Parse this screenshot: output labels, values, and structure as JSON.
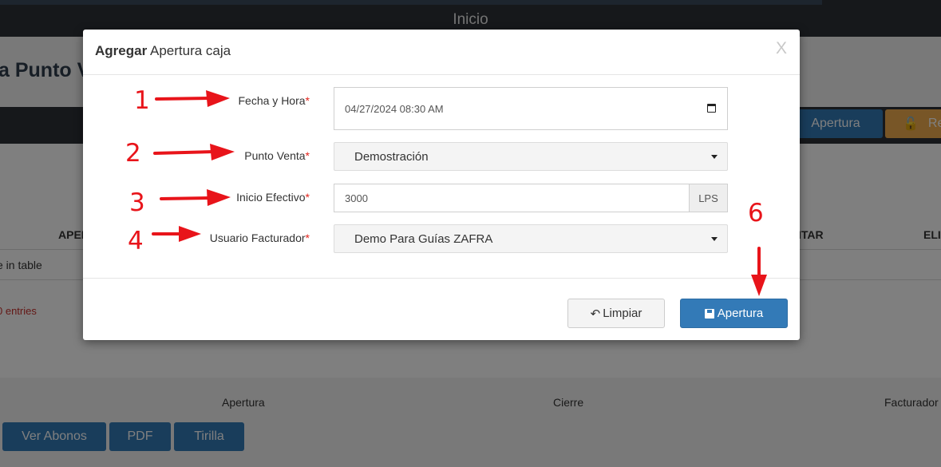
{
  "background": {
    "topbar_title": "Inicio",
    "page_title": "a Punto Ve",
    "apertura_button": "Apertura",
    "reabrir_button": "Re",
    "table_headers": [
      "APER",
      "ITAR",
      "ELI"
    ],
    "empty_text": "e in table",
    "entries_text": "entries",
    "column_labels": [
      "Apertura",
      "Cierre",
      "Facturador"
    ],
    "bottom_buttons": [
      "Ver Abonos",
      "PDF",
      "Tirilla"
    ]
  },
  "modal": {
    "title_bold": "Agregar",
    "title_rest": "Apertura caja",
    "close": "X",
    "fields": {
      "fecha": {
        "label": "Fecha y Hora",
        "required": "*",
        "value": "04/27/2024 08:30  AM"
      },
      "punto_venta": {
        "label": "Punto Venta",
        "required": "*",
        "value": "Demostración"
      },
      "inicio_efectivo": {
        "label": "Inicio Efectivo",
        "required": "*",
        "value": "3000",
        "addon": "LPS"
      },
      "usuario": {
        "label": "Usuario Facturador",
        "required": "*",
        "value": "Demo Para Guías ZAFRA"
      }
    },
    "buttons": {
      "limpiar": "Limpiar",
      "apertura": "Apertura"
    }
  },
  "annotations": {
    "numbers": [
      "1",
      "2",
      "3",
      "4",
      "6"
    ]
  },
  "colors": {
    "primary": "#337ab7",
    "warning": "#f0ad4e",
    "required": "#e2241c",
    "annotation": "#e8141a"
  }
}
